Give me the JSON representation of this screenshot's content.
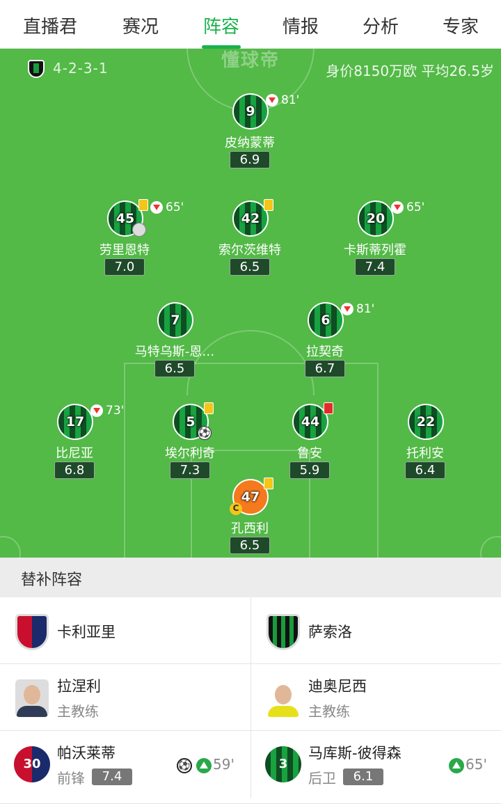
{
  "tabs": [
    "直播君",
    "赛况",
    "阵容",
    "情报",
    "分析",
    "专家"
  ],
  "active_tab": "阵容",
  "pitch": {
    "watermark": "懂球帝",
    "formation": "4-2-3-1",
    "value_info": "身价8150万欧  平均26.5岁"
  },
  "players": [
    {
      "num": "9",
      "name": "皮纳蒙蒂",
      "rating": "6.9",
      "sub_out": "81'"
    },
    {
      "num": "45",
      "name": "劳里恩特",
      "rating": "7.0",
      "sub_out": "65'"
    },
    {
      "num": "42",
      "name": "索尔茨维特",
      "rating": "6.5"
    },
    {
      "num": "20",
      "name": "卡斯蒂列霍",
      "rating": "7.4",
      "sub_out": "65'"
    },
    {
      "num": "7",
      "name": "马特乌斯-恩…",
      "rating": "6.5"
    },
    {
      "num": "6",
      "name": "拉契奇",
      "rating": "6.7",
      "sub_out": "81'"
    },
    {
      "num": "17",
      "name": "比尼亚",
      "rating": "6.8",
      "sub_out": "73'"
    },
    {
      "num": "5",
      "name": "埃尔利奇",
      "rating": "7.3"
    },
    {
      "num": "44",
      "name": "鲁安",
      "rating": "5.9"
    },
    {
      "num": "22",
      "name": "托利安",
      "rating": "6.4"
    },
    {
      "num": "47",
      "name": "孔西利",
      "rating": "6.5",
      "captain": "C"
    }
  ],
  "subs": {
    "title": "替补阵容",
    "teams": {
      "home": "卡利亚里",
      "away": "萨索洛"
    },
    "coaches": {
      "home": {
        "name": "拉涅利",
        "role": "主教练"
      },
      "away": {
        "name": "迪奥尼西",
        "role": "主教练"
      }
    },
    "sub_players": {
      "home": {
        "num": "30",
        "name": "帕沃莱蒂",
        "pos": "前锋",
        "rating": "7.4",
        "in_time": "59'"
      },
      "away": {
        "num": "3",
        "name": "马库斯-彼得森",
        "pos": "后卫",
        "rating": "6.1",
        "in_time": "65'"
      }
    }
  }
}
